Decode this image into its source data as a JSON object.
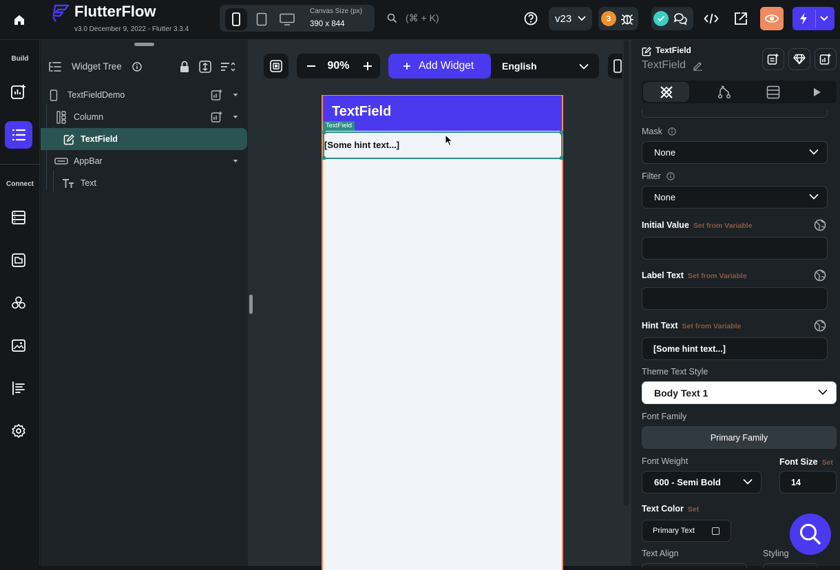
{
  "topbar": {
    "app_name": "FlutterFlow",
    "version_info": "v3.0 December 9, 2022 - Flutter 3.3.4",
    "canvas_size_label": "Canvas Size (px)",
    "canvas_size_value": "390 x 844",
    "search_shortcut": "(⌘ + K)",
    "version_select": "v23",
    "issues_count": "3"
  },
  "rail": {
    "build_label": "Build",
    "connect_label": "Connect"
  },
  "tree": {
    "title": "Widget Tree",
    "items": [
      {
        "label": "TextFieldDemo"
      },
      {
        "label": "Column"
      },
      {
        "label": "TextField"
      },
      {
        "label": "AppBar"
      },
      {
        "label": "Text"
      }
    ]
  },
  "canvas": {
    "zoom": "90%",
    "add_widget_label": "Add Widget",
    "language": "English",
    "appbar_title": "TextField",
    "selection_tag": "TextField",
    "hint_text": "[Some hint text...]"
  },
  "props": {
    "widget_type": "TextField",
    "widget_name": "TextField",
    "mask_label": "Mask",
    "mask_value": "None",
    "filter_label": "Filter",
    "filter_value": "None",
    "initial_value_label": "Initial Value",
    "label_text_label": "Label Text",
    "hint_text_label": "Hint Text",
    "set_from_variable": "Set from Variable",
    "hint_text_value": "[Some hint text...]",
    "theme_text_style_label": "Theme Text Style",
    "theme_text_style_value": "Body Text 1",
    "font_family_label": "Font Family",
    "font_family_value": "Primary Family",
    "font_weight_label": "Font Weight",
    "font_weight_value": "600 - Semi Bold",
    "font_size_label": "Font Size",
    "font_size_set": "Set",
    "font_size_value": "14",
    "text_color_label": "Text Color",
    "text_color_set": "Set",
    "text_color_value": "Primary Text",
    "text_align_label": "Text Align",
    "styling_label": "Styling"
  },
  "colors": {
    "accent": "#4b39ef",
    "orange": "#ee8b60",
    "teal_selection": "#2a5452",
    "green_check": "#39d2c0"
  }
}
